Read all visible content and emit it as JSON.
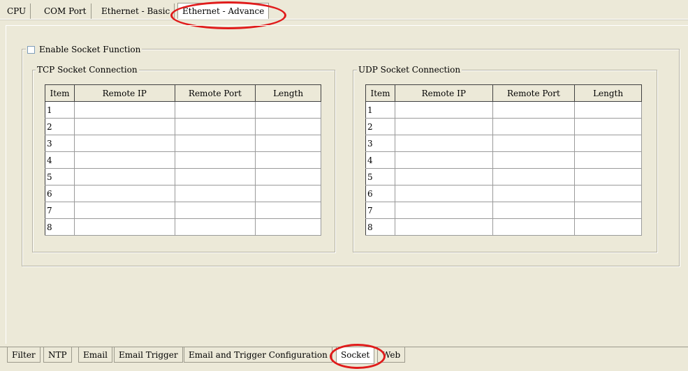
{
  "top_tabs": [
    "CPU",
    "COM Port",
    "Ethernet - Basic",
    "Ethernet - Advance"
  ],
  "enable_socket_label": "Enable Socket Function",
  "tcp": {
    "title": "TCP Socket Connection",
    "headers": [
      "Item",
      "Remote IP",
      "Remote Port",
      "Length"
    ],
    "rows": [
      "1",
      "2",
      "3",
      "4",
      "5",
      "6",
      "7",
      "8"
    ]
  },
  "udp": {
    "title": "UDP Socket Connection",
    "headers": [
      "Item",
      "Remote IP",
      "Remote Port",
      "Length"
    ],
    "rows": [
      "1",
      "2",
      "3",
      "4",
      "5",
      "6",
      "7",
      "8"
    ]
  },
  "bottom_tabs": [
    "Filter",
    "NTP",
    "Email",
    "Email Trigger",
    "Email and Trigger Configuration",
    "Socket",
    "Web"
  ],
  "active_top_tab": "Ethernet - Advance",
  "active_bottom_tab": "Socket",
  "colors": {
    "highlight": "#e01b1b",
    "background": "#ece9d8"
  }
}
